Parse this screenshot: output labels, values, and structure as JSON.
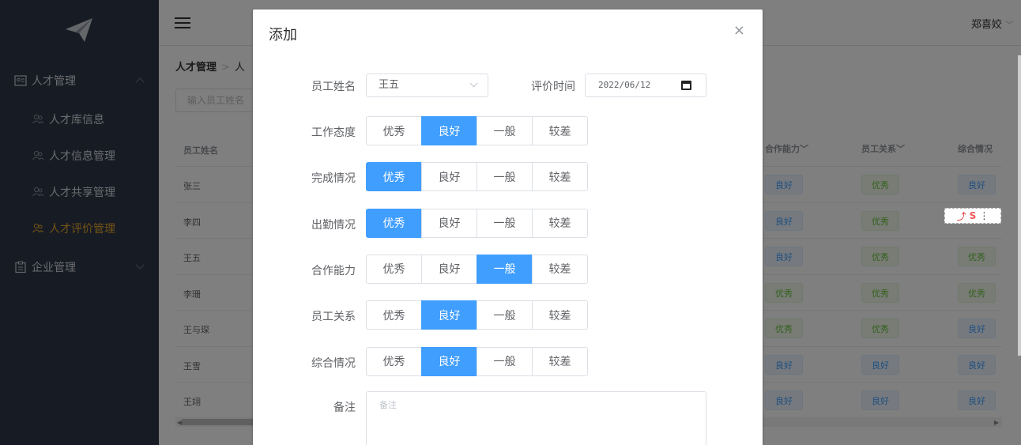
{
  "sidebar": {
    "groups": [
      {
        "label": "人才管理",
        "expanded": true
      },
      {
        "label": "企业管理",
        "expanded": false
      }
    ],
    "items": [
      {
        "label": "人才库信息",
        "active": false
      },
      {
        "label": "人才信息管理",
        "active": false
      },
      {
        "label": "人才共享管理",
        "active": false
      },
      {
        "label": "人才评价管理",
        "active": true
      }
    ]
  },
  "header": {
    "user": "郑喜姣"
  },
  "breadcrumb": {
    "first": "人才管理",
    "second": "人"
  },
  "search": {
    "placeholder": "输入员工姓名"
  },
  "table": {
    "headers": {
      "name": "员工姓名",
      "cooperation": "合作能力",
      "relations": "员工关系",
      "overall": "综合情况"
    },
    "rows": [
      {
        "name": "张三",
        "cooperation": "良好",
        "relations": "优秀",
        "overall": "良好"
      },
      {
        "name": "李四",
        "cooperation": "良好",
        "relations": "优秀",
        "overall": ""
      },
      {
        "name": "王五",
        "cooperation": "良好",
        "relations": "优秀",
        "overall": "优秀"
      },
      {
        "name": "李珊",
        "cooperation": "优秀",
        "relations": "优秀",
        "overall": "优秀"
      },
      {
        "name": "王与琛",
        "cooperation": "优秀",
        "relations": "优秀",
        "overall": "良好"
      },
      {
        "name": "王雪",
        "cooperation": "良好",
        "relations": "良好",
        "overall": "良好"
      },
      {
        "name": "王翊",
        "cooperation": "良好",
        "relations": "良好",
        "overall": "良好"
      }
    ]
  },
  "dialog": {
    "title": "添加",
    "close": "×",
    "name_label": "员工姓名",
    "name_value": "王五",
    "date_label": "评价时间",
    "date_value": "2022/06/12",
    "options": [
      "优秀",
      "良好",
      "一般",
      "较差"
    ],
    "ratings": [
      {
        "label": "工作态度",
        "selected": 1
      },
      {
        "label": "完成情况",
        "selected": 0
      },
      {
        "label": "出勤情况",
        "selected": 0
      },
      {
        "label": "合作能力",
        "selected": 2
      },
      {
        "label": "员工关系",
        "selected": 1
      },
      {
        "label": "综合情况",
        "selected": 1
      }
    ],
    "remark_label": "备注",
    "remark_placeholder": "备注"
  },
  "colors": {
    "primary": "#409eff",
    "sidebar_bg": "#2f3749",
    "active_menu": "#e8a92b"
  }
}
